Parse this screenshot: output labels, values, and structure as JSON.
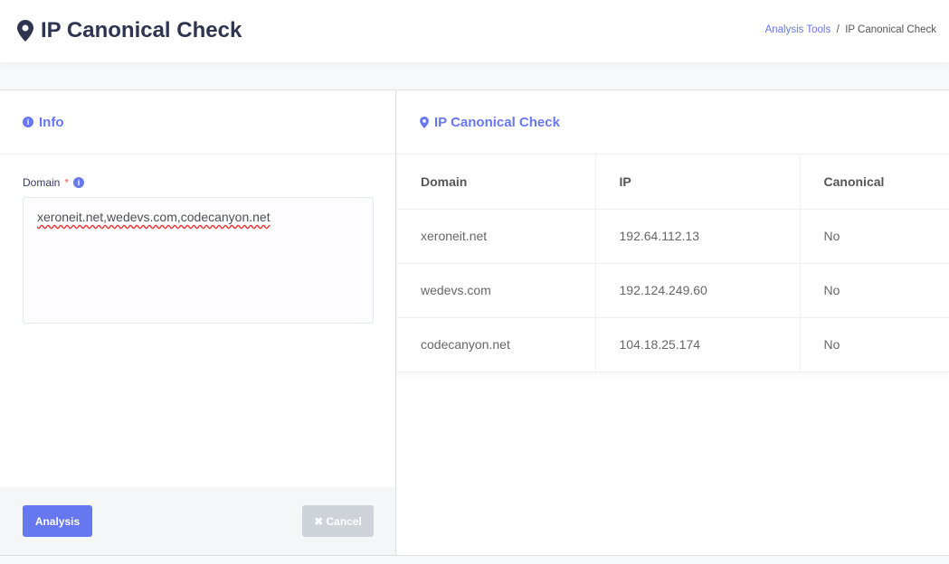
{
  "header": {
    "title": "IP Canonical Check",
    "breadcrumb": [
      "Analysis Tools",
      "IP Canonical Check"
    ],
    "separator": "/"
  },
  "form": {
    "title": "Info",
    "domain_label": "Domain",
    "required_mark": "*",
    "domain_value": "xeroneit.net,wedevs.com,codecanyon.net",
    "analysis_label": "Analysis",
    "cancel_label": "Cancel"
  },
  "results": {
    "title": "IP Canonical Check",
    "columns": [
      "Domain",
      "IP",
      "Canonical"
    ],
    "rows": [
      [
        "xeroneit.net",
        "192.64.112.13",
        "No"
      ],
      [
        "wedevs.com",
        "192.124.249.60",
        "No"
      ],
      [
        "codecanyon.net",
        "104.18.25.174",
        "No"
      ]
    ]
  },
  "colors": {
    "accent": "#6777ef",
    "title": "#2f3450"
  }
}
